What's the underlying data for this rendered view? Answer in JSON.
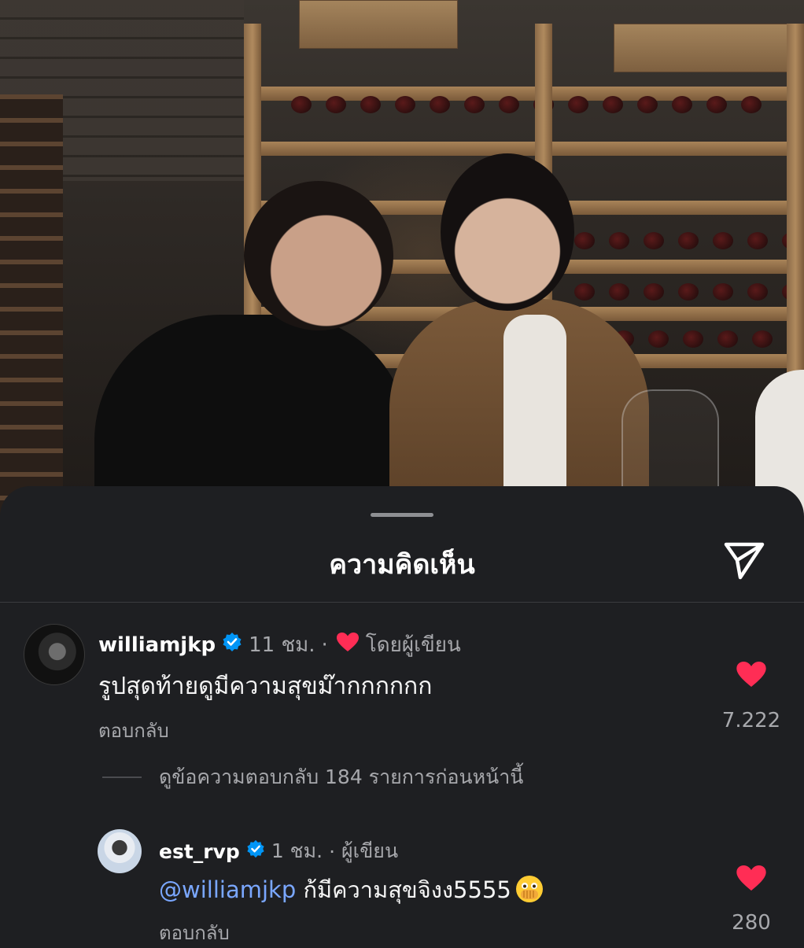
{
  "sheet": {
    "title": "ความคิดเห็น",
    "share_icon": "paper-plane-icon"
  },
  "comments": [
    {
      "username": "williamjkp",
      "verified": true,
      "time": "11 ชม.",
      "liked_by_author_label": "โดยผู้เขียน",
      "text": "รูปสุดท้ายดูมีความสุขม๊ากกกกกก",
      "reply_label": "ตอบกลับ",
      "likes": "7.222",
      "liked": true
    },
    {
      "username": "est_rvp",
      "verified": true,
      "time": "1 ชม.",
      "author_label": "ผู้เขียน",
      "mention": "@williamjkp",
      "text": " ก้มีความสุขจิงง5555",
      "emoji": "face-with-open-eyes-and-hand-over-mouth",
      "reply_label": "ตอบกลับ",
      "likes": "280",
      "liked": true
    }
  ],
  "view_replies_label": "ดูข้อความตอบกลับ 184 รายการก่อนหน้านี้",
  "colors": {
    "heart": "#ff2d55",
    "verified": "#0095f6",
    "mention": "#7aa7ff",
    "sheet_bg": "#1e1f22"
  }
}
